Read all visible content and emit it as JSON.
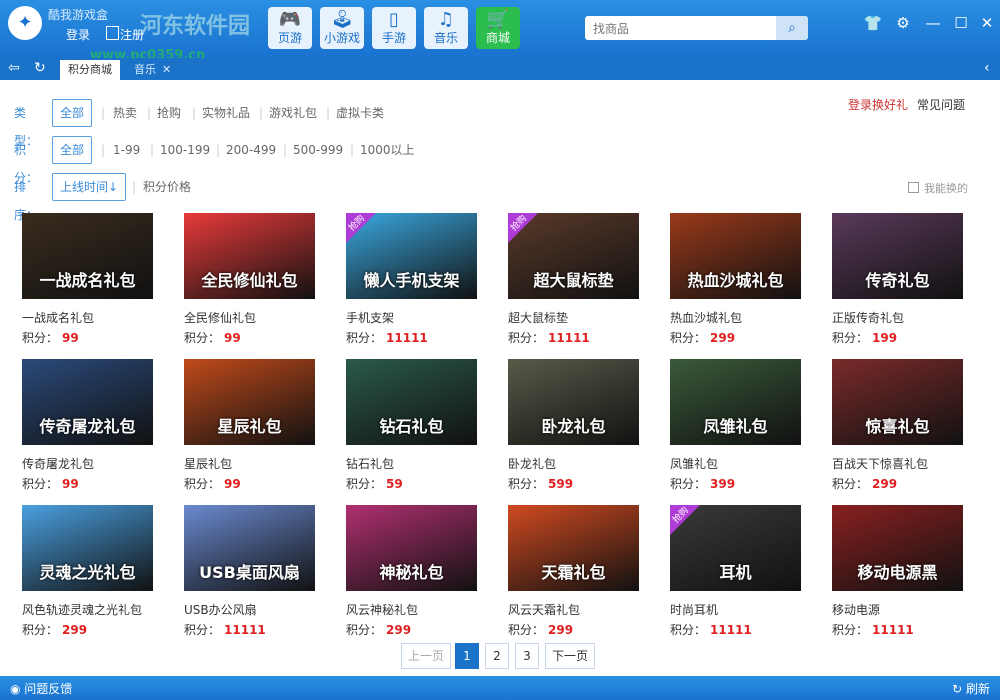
{
  "window": {
    "app_title": "酷我游戏盒",
    "login_label": "登录",
    "register_label": "注册",
    "watermark_text": "河东软件园",
    "watermark_url": "www.pc0359.cn"
  },
  "nav": [
    {
      "label": "页游",
      "icon": "gamepad-icon",
      "glyph": "🎮",
      "active": false
    },
    {
      "label": "小游戏",
      "icon": "joystick-icon",
      "glyph": "🕹",
      "active": false
    },
    {
      "label": "手游",
      "icon": "phone-icon",
      "glyph": "▯",
      "active": false
    },
    {
      "label": "音乐",
      "icon": "music-icon",
      "glyph": "♫",
      "active": false
    },
    {
      "label": "商城",
      "icon": "cart-icon",
      "glyph": "🛒",
      "active": true
    }
  ],
  "search": {
    "placeholder": "找商品"
  },
  "tabs": [
    {
      "label": "积分商城",
      "active": true
    },
    {
      "label": "音乐",
      "active": false
    }
  ],
  "filters": {
    "type_label": "类型：",
    "type_options": [
      "全部",
      "热卖",
      "抢购",
      "实物礼品",
      "游戏礼包",
      "虚拟卡类"
    ],
    "score_label": "积分：",
    "score_options": [
      "全部",
      "1-99",
      "100-199",
      "200-499",
      "500-999",
      "1000以上"
    ],
    "sort_label": "排序：",
    "sort_options": [
      "上线时间↓",
      "积分价格"
    ],
    "exchange_link": "登录换好礼",
    "faq_link": "常见问题",
    "only_affordable": "我能换的"
  },
  "score_prefix": "积分：",
  "products": [
    {
      "name": "一战成名礼包",
      "score": "99",
      "banner": "一战成名礼包",
      "bg": "#3a2c1e",
      "badge": false
    },
    {
      "name": "全民修仙礼包",
      "score": "99",
      "banner": "全民修仙礼包",
      "bg": "#e83a3a",
      "badge": false
    },
    {
      "name": "手机支架",
      "score": "11111",
      "banner": "懒人手机支架",
      "bg": "#3aa8e0",
      "badge": true
    },
    {
      "name": "超大鼠标垫",
      "score": "11111",
      "banner": "超大鼠标垫",
      "bg": "#5a3a2a",
      "badge": true
    },
    {
      "name": "热血沙城礼包",
      "score": "299",
      "banner": "热血沙城礼包",
      "bg": "#9a3a1a",
      "badge": false
    },
    {
      "name": "正版传奇礼包",
      "score": "199",
      "banner": "传奇礼包",
      "bg": "#5a3a5a",
      "badge": false
    },
    {
      "name": "传奇屠龙礼包",
      "score": "99",
      "banner": "传奇屠龙礼包",
      "bg": "#2a4a7a",
      "badge": false
    },
    {
      "name": "星辰礼包",
      "score": "99",
      "banner": "星辰礼包",
      "bg": "#c04a1a",
      "badge": false
    },
    {
      "name": "钻石礼包",
      "score": "59",
      "banner": "钻石礼包",
      "bg": "#2a5a4a",
      "badge": false
    },
    {
      "name": "卧龙礼包",
      "score": "599",
      "banner": "卧龙礼包",
      "bg": "#5a5a4a",
      "badge": false
    },
    {
      "name": "凤雏礼包",
      "score": "399",
      "banner": "凤雏礼包",
      "bg": "#3a5a3a",
      "badge": false
    },
    {
      "name": "百战天下惊喜礼包",
      "score": "299",
      "banner": "惊喜礼包",
      "bg": "#7a2a2a",
      "badge": false
    },
    {
      "name": "风色轨迹灵魂之光礼包",
      "score": "299",
      "banner": "灵魂之光礼包",
      "bg": "#4aa0e0",
      "badge": false
    },
    {
      "name": "USB办公风扇",
      "score": "11111",
      "banner": "USB桌面风扇",
      "bg": "#6a8ad0",
      "badge": false
    },
    {
      "name": "风云神秘礼包",
      "score": "299",
      "banner": "神秘礼包",
      "bg": "#b03070",
      "badge": false
    },
    {
      "name": "风云天霜礼包",
      "score": "299",
      "banner": "天霜礼包",
      "bg": "#d04a20",
      "badge": false
    },
    {
      "name": "时尚耳机",
      "score": "11111",
      "banner": "耳机",
      "bg": "#3a3a3a",
      "badge": true
    },
    {
      "name": "移动电源",
      "score": "11111",
      "banner": "移动电源黑",
      "bg": "#8a2020",
      "badge": false
    }
  ],
  "badge_text": "抢购",
  "pagination": {
    "prev": "上一页",
    "pages": [
      "1",
      "2",
      "3"
    ],
    "current": "1",
    "next": "下一页"
  },
  "status": {
    "feedback": "问题反馈",
    "refresh": "刷新"
  }
}
